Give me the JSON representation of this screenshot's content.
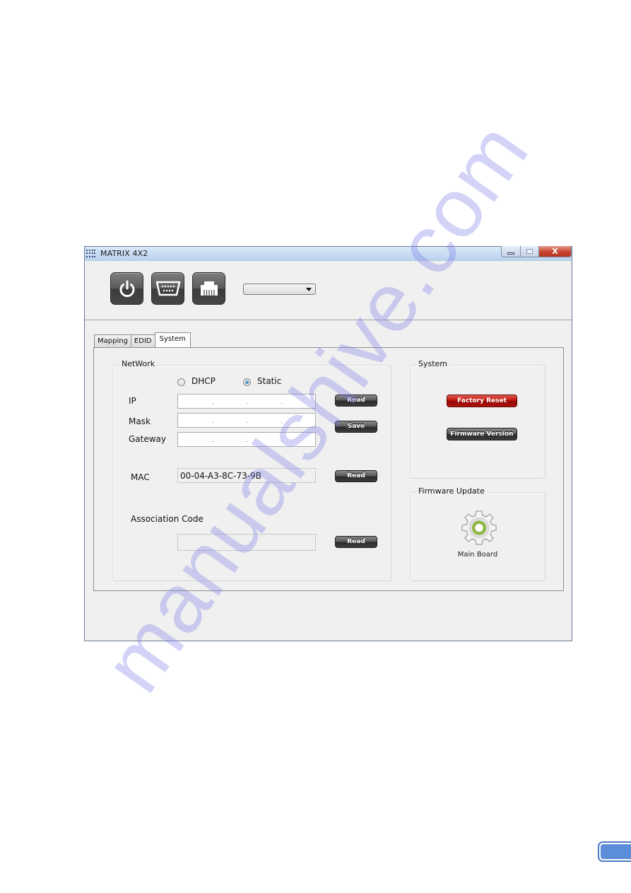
{
  "window": {
    "title": "MATRIX 4X2",
    "controls": {
      "minimize": "minimize",
      "maximize": "maximize",
      "close": "X"
    }
  },
  "toolbar": {
    "buttons": [
      {
        "name": "power",
        "icon": "power-icon"
      },
      {
        "name": "serial",
        "icon": "serial-port-icon"
      },
      {
        "name": "lan",
        "icon": "ethernet-port-icon"
      }
    ],
    "device_select": {
      "value": ""
    }
  },
  "tabs": [
    {
      "label": "Mapping",
      "active": false
    },
    {
      "label": "EDID",
      "active": false
    },
    {
      "label": "System",
      "active": true
    }
  ],
  "network": {
    "legend": "NetWork",
    "mode_options": [
      {
        "label": "DHCP",
        "checked": false
      },
      {
        "label": "Static",
        "checked": true
      }
    ],
    "ip": {
      "label": "IP",
      "value": ""
    },
    "mask": {
      "label": "Mask",
      "value": ""
    },
    "gateway": {
      "label": "Gateway",
      "value": ""
    },
    "read_ip_label": "Read",
    "save_label": "Save",
    "mac": {
      "label": "MAC",
      "value": "00-04-A3-8C-73-9B",
      "read_label": "Read"
    },
    "association": {
      "label": "Association Code",
      "value": "",
      "read_label": "Read"
    }
  },
  "system": {
    "legend": "System",
    "factory_reset_label": "Factory Reset",
    "firmware_version_label": "Firmware Version",
    "colors": {
      "danger": "#c4150f",
      "dark": "#3e3e3e"
    }
  },
  "firmware_update": {
    "legend": "Firmware Update",
    "icon": "gear-icon",
    "caption": "Main Board",
    "accent": "#8cb83a"
  },
  "watermark": "manualshive.com"
}
